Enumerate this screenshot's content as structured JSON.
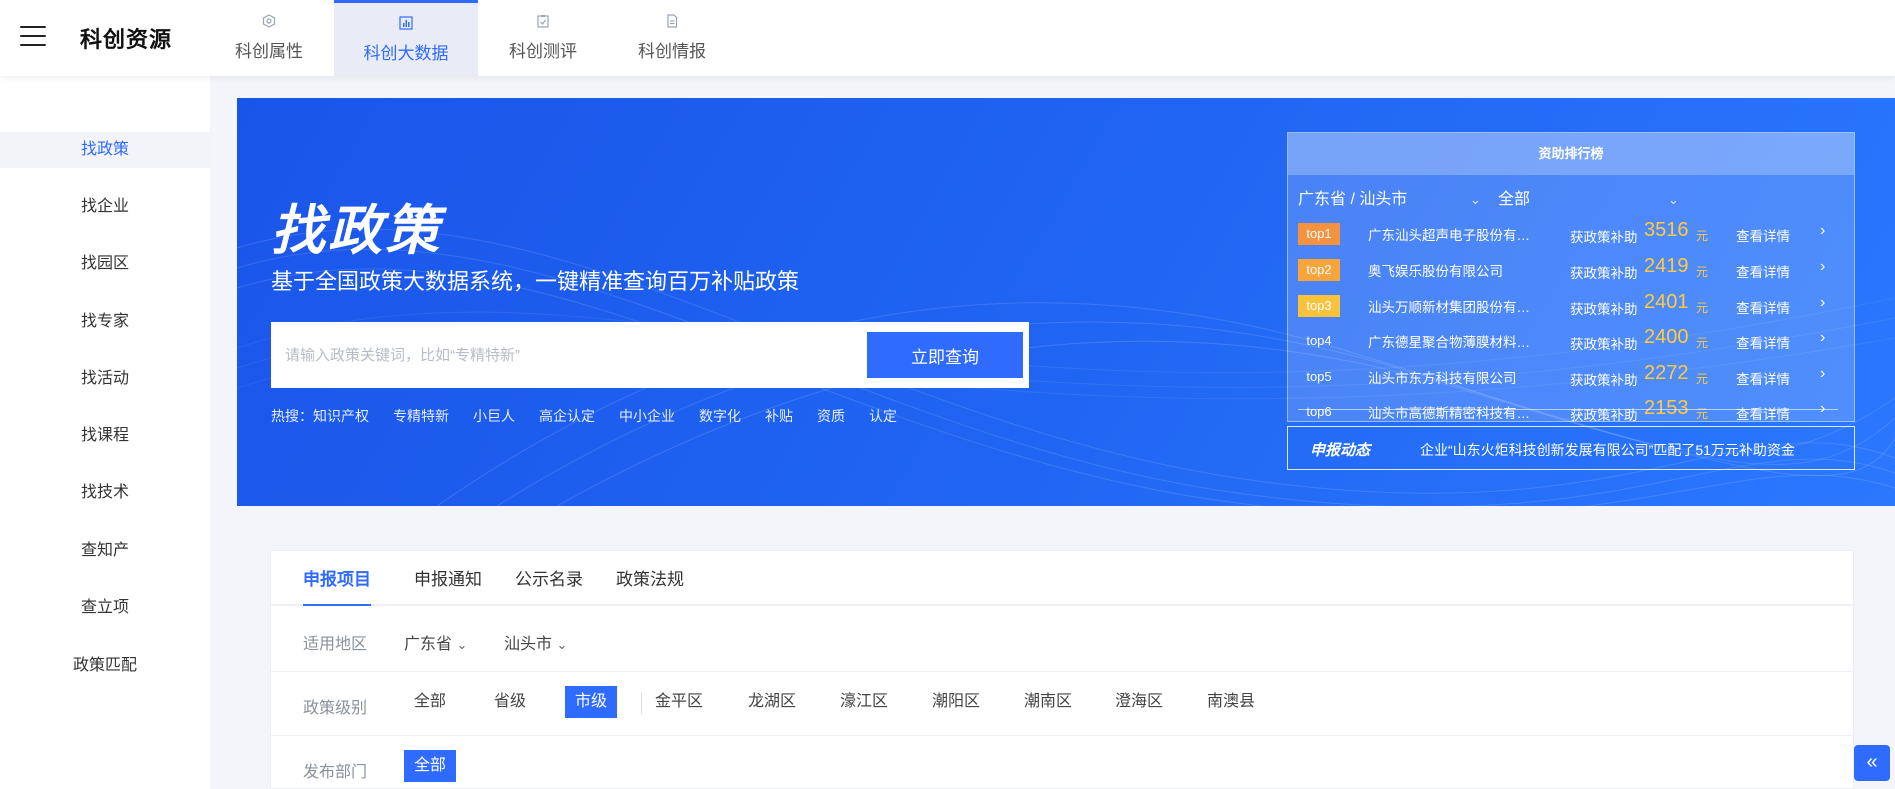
{
  "header": {
    "brand": "科创资源",
    "tabs": [
      {
        "label": "科创属性",
        "icon": "hexagon-icon"
      },
      {
        "label": "科创大数据",
        "icon": "chart-icon"
      },
      {
        "label": "科创测评",
        "icon": "clipboard-check-icon"
      },
      {
        "label": "科创情报",
        "icon": "document-icon"
      }
    ],
    "active_tab": "科创大数据"
  },
  "sidebar": {
    "items": [
      "找政策",
      "找企业",
      "找园区",
      "找专家",
      "找活动",
      "找课程",
      "找技术",
      "查知产",
      "查立项",
      "政策匹配"
    ],
    "active": "找政策"
  },
  "hero": {
    "title": "找政策",
    "subtitle": "基于全国政策大数据系统，一键精准查询百万补贴政策",
    "search": {
      "placeholder": "请输入政策关键词，比如“专精特新”",
      "button": "立即查询"
    },
    "hot_prefix": "热搜：",
    "hot_tags": [
      "知识产权",
      "专精特新",
      "小巨人",
      "高企认定",
      "中小企业",
      "数字化",
      "补贴",
      "资质",
      "认定"
    ]
  },
  "ranking": {
    "title": "资助排行榜",
    "region_filter": "广东省 / 汕头市",
    "type_filter": "全部",
    "rows": [
      {
        "rank": "top1",
        "company": "广东汕头超声电子股份有限公司",
        "type": "获政策补助",
        "amount": "3516",
        "unit": "元",
        "detail": "查看详情"
      },
      {
        "rank": "top2",
        "company": "奥飞娱乐股份有限公司",
        "type": "获政策补助",
        "amount": "2419",
        "unit": "元",
        "detail": "查看详情"
      },
      {
        "rank": "top3",
        "company": "汕头万顺新材集团股份有限公司",
        "type": "获政策补助",
        "amount": "2401",
        "unit": "元",
        "detail": "查看详情"
      },
      {
        "rank": "top4",
        "company": "广东德星聚合物薄膜材料研究院",
        "type": "获政策补助",
        "amount": "2400",
        "unit": "元",
        "detail": "查看详情"
      },
      {
        "rank": "top5",
        "company": "汕头市东方科技有限公司",
        "type": "获政策补助",
        "amount": "2272",
        "unit": "元",
        "detail": "查看详情"
      },
      {
        "rank": "top6",
        "company": "汕头市高德斯精密科技有限公司",
        "type": "获政策补助",
        "amount": "2153",
        "unit": "元",
        "detail": "查看详情"
      }
    ],
    "badge_colors": {
      "top1": "#f5923e",
      "top2": "#f7a43a",
      "top3": "#f8c23a"
    }
  },
  "news": {
    "label": "申报动态",
    "text": "企业“山东火炬科技创新发展有限公司”匹配了51万元补助资金"
  },
  "content": {
    "tabs": [
      "申报项目",
      "申报通知",
      "公示名录",
      "政策法规"
    ],
    "active_tab": "申报项目",
    "region": {
      "label": "适用地区",
      "province": "广东省",
      "city": "汕头市"
    },
    "level": {
      "label": "政策级别",
      "options": [
        "全部",
        "省级",
        "市级"
      ],
      "active": "市级",
      "districts": [
        "金平区",
        "龙湖区",
        "濠江区",
        "潮阳区",
        "潮南区",
        "澄海区",
        "南澳县"
      ]
    },
    "department": {
      "label": "发布部门",
      "options": [
        "全部"
      ],
      "active": "全部"
    }
  },
  "float_button": {
    "icon": "double-chevron-left-icon",
    "glyph": "«"
  },
  "colors": {
    "accent": "#2f6bff",
    "hero": "#1f63f0",
    "amount": "#ffcb3d"
  }
}
